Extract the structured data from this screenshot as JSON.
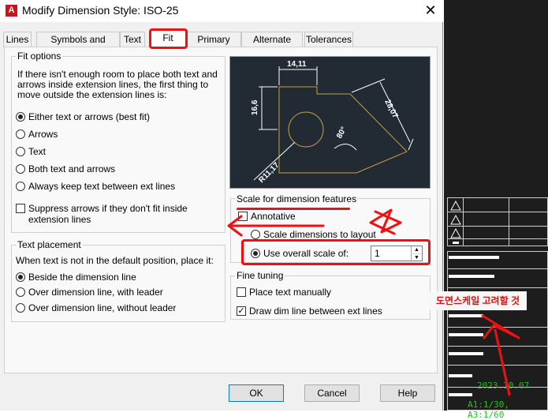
{
  "window": {
    "title": "Modify Dimension Style: ISO-25",
    "app_icon_letter": "A",
    "close_glyph": "✕"
  },
  "tabs": [
    {
      "label": "Lines"
    },
    {
      "label": "Symbols and Arrows"
    },
    {
      "label": "Text"
    },
    {
      "label": "Fit"
    },
    {
      "label": "Primary Units"
    },
    {
      "label": "Alternate Units"
    },
    {
      "label": "Tolerances"
    }
  ],
  "active_tab": "Fit",
  "fit_options": {
    "legend": "Fit options",
    "description": [
      "If there isn't enough room to place both text and",
      "arrows inside extension lines, the first thing to",
      "move outside the extension lines is:"
    ],
    "options": [
      {
        "label": "Either text or arrows (best fit)",
        "selected": true
      },
      {
        "label": "Arrows",
        "selected": false
      },
      {
        "label": "Text",
        "selected": false
      },
      {
        "label": "Both text and arrows",
        "selected": false
      },
      {
        "label": "Always keep text between ext lines",
        "selected": false
      }
    ],
    "suppress_label": [
      "Suppress arrows if they don't fit inside",
      "extension lines"
    ],
    "suppress_checked": false
  },
  "text_placement": {
    "legend": "Text placement",
    "description": "When text is not in the default position, place it:",
    "options": [
      {
        "label": "Beside the dimension line",
        "selected": true
      },
      {
        "label": "Over dimension line, with leader",
        "selected": false
      },
      {
        "label": "Over dimension line, without leader",
        "selected": false
      }
    ]
  },
  "preview": {
    "dim_top": "14,11",
    "dim_left": "16,6",
    "dim_right": "28,07",
    "dim_angle": "80°",
    "dim_radius": "R11,17"
  },
  "scale": {
    "legend": "Scale for dimension features",
    "annotative_label": "Annotative",
    "annotative_checked": false,
    "layout_label": "Scale dimensions to layout",
    "overall_label": "Use overall scale of:",
    "overall_selected": true,
    "overall_value": "1"
  },
  "fine_tuning": {
    "legend": "Fine tuning",
    "manual_label": "Place text manually",
    "manual_checked": false,
    "drawdim_label": "Draw dim line between ext lines",
    "drawdim_checked": true
  },
  "buttons": {
    "ok": "OK",
    "cancel": "Cancel",
    "help": "Help"
  },
  "annotation": {
    "note": "도면스케일 고려할 것"
  },
  "drawing": {
    "date": "2023.10.07",
    "scale_text": "A1:1/30, A3:1/60"
  },
  "colors": {
    "annotation_red": "#ee1111",
    "preview_bg": "#222a34",
    "preview_line": "#c8a040",
    "drawing_bg": "#1d1d1d",
    "green_text": "#22c022"
  }
}
